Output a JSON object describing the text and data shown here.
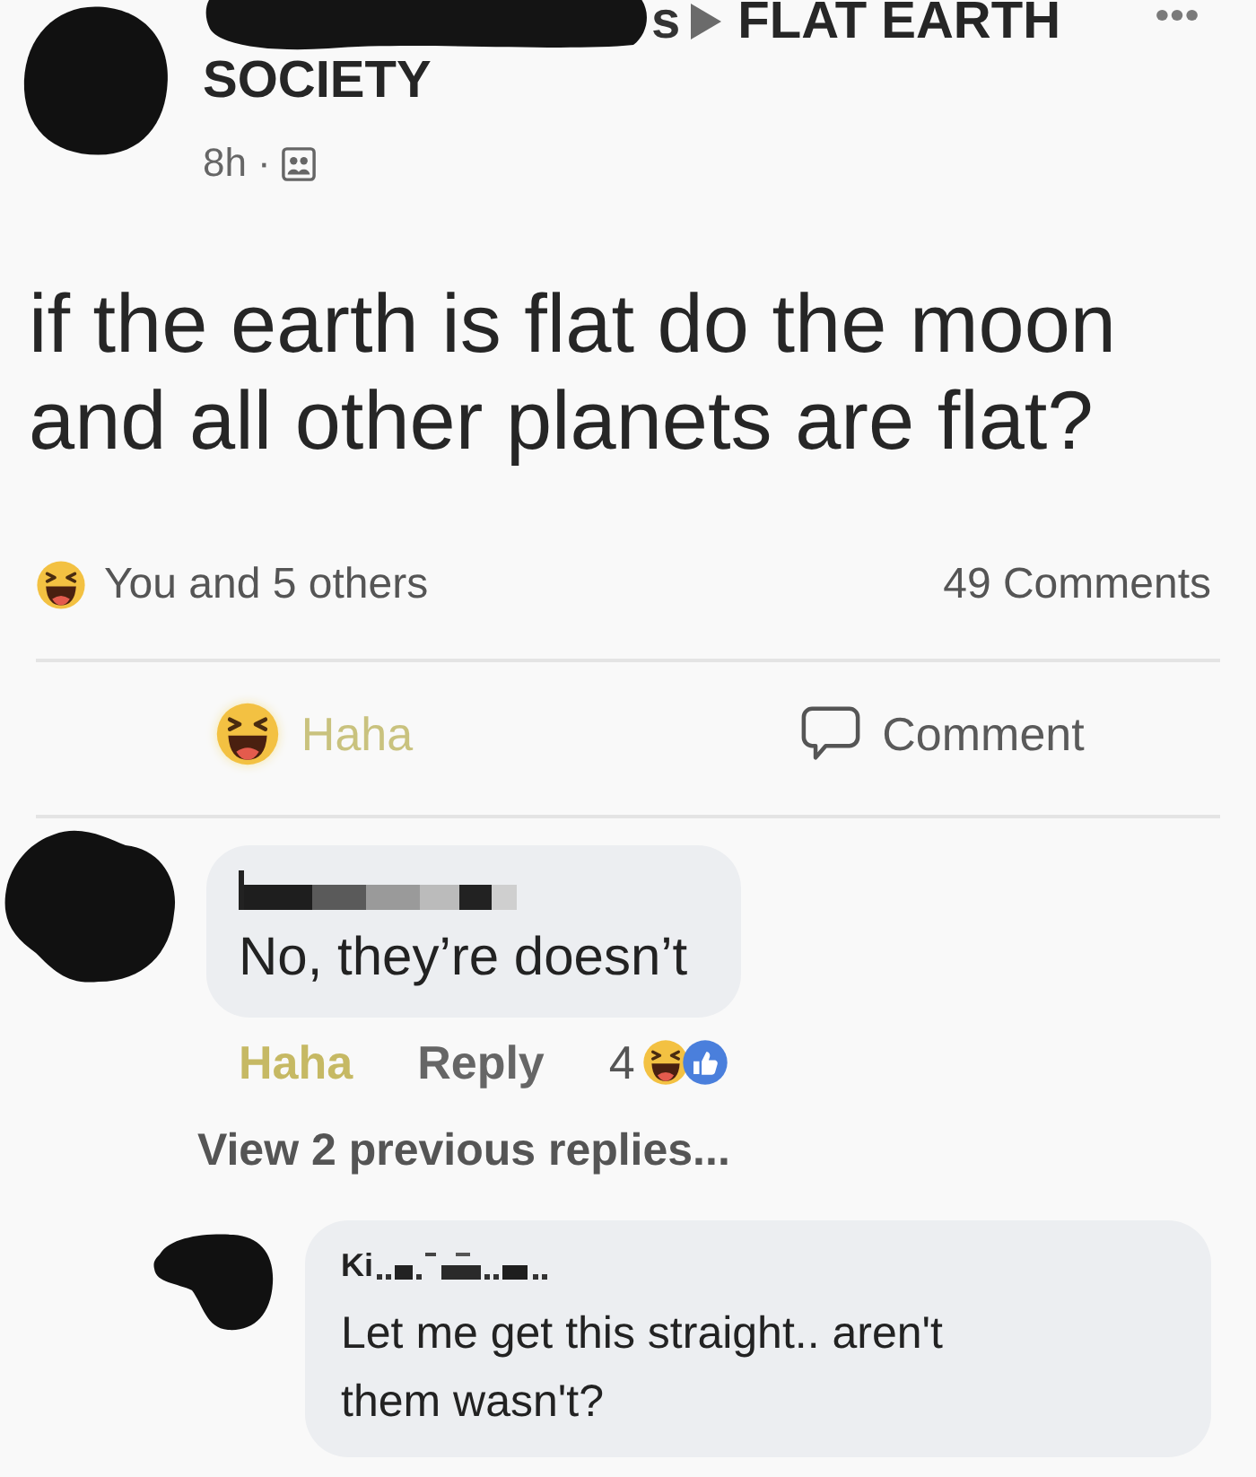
{
  "post": {
    "author_name_visible": "s",
    "group_name_lines": [
      "FLAT EARTH",
      "SOCIETY"
    ],
    "time": "8h",
    "separator": "·",
    "text": "if the earth is flat do the moon and all other planets are flat?"
  },
  "summary": {
    "reactions_text": "You and 5 others",
    "comments_count": "49 Comments"
  },
  "actions": [
    {
      "kind": "haha",
      "label": "Haha",
      "selected": true
    },
    {
      "kind": "comment",
      "label": "Comment",
      "selected": false
    }
  ],
  "comments": [
    {
      "text": "No, they’re doesn’t",
      "actions": [
        {
          "label": "Haha",
          "selected": true
        },
        {
          "label": "Reply",
          "selected": false
        }
      ],
      "reaction_count": "4",
      "reaction_icons": [
        {
          "kind": "haha"
        },
        {
          "kind": "like"
        }
      ],
      "replies_link": "View 2 previous replies...",
      "replies": [
        {
          "name_visible": "Ki",
          "text": "Let me get this straight.. aren't them wasn't?"
        }
      ]
    }
  ]
}
